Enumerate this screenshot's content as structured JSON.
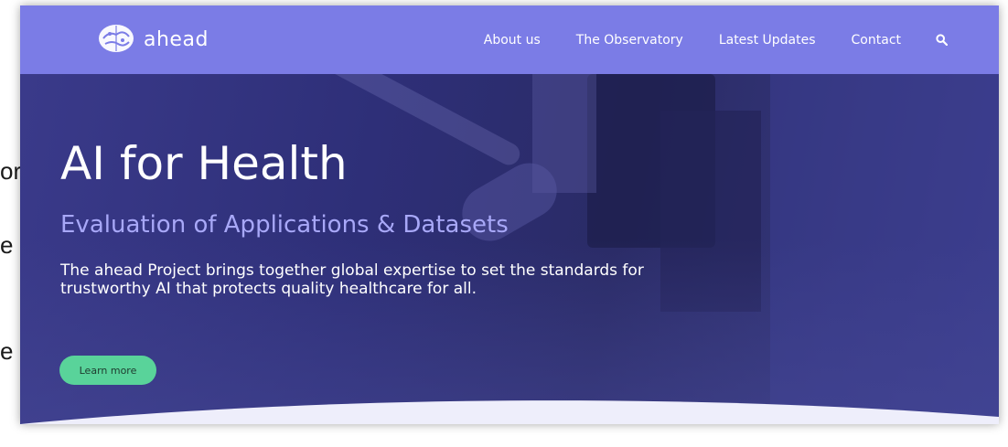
{
  "background_doc": {
    "fragments": [
      "or",
      "e",
      "e"
    ]
  },
  "nav": {
    "logo_text": "ahead",
    "logo_icon": "brain-globe-icon",
    "links": [
      "About us",
      "The Observatory",
      "Latest Updates",
      "Contact"
    ],
    "search_icon": "search-icon"
  },
  "hero": {
    "title": "AI for Health",
    "subtitle": "Evaluation of Applications & Datasets",
    "description": "The ahead Project brings together global expertise to set the standards for trustworthy AI that protects quality healthcare for all.",
    "cta_label": "Learn more"
  },
  "colors": {
    "nav_bg": "#7b7ce6",
    "hero_bg": "#2e2f78",
    "subtitle": "#a8a8f8",
    "cta_bg": "#59d39a",
    "wave": "#eeeefb"
  }
}
